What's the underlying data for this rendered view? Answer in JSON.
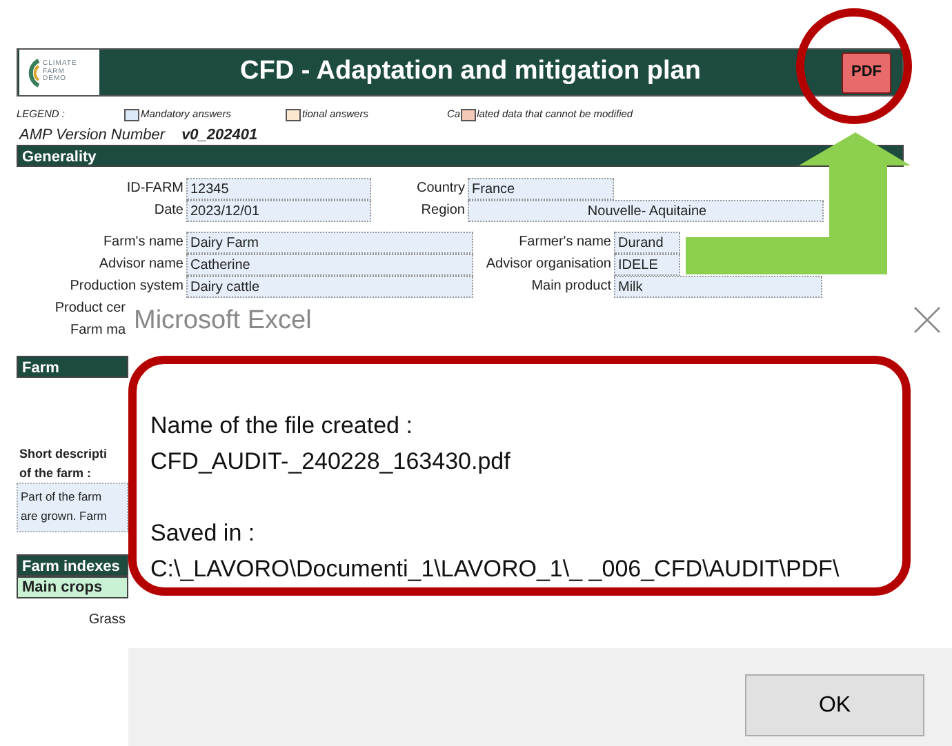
{
  "sheet": {
    "logo": {
      "lines": [
        "CLIMATE",
        "FARM",
        "DEMO"
      ]
    },
    "title": "CFD - Adaptation and mitigation plan",
    "pdf_button": {
      "label": "PDF"
    },
    "legend": {
      "label": "LEGEND :",
      "items": [
        {
          "text": "Mandatory answers",
          "color": "#dce9f7"
        },
        {
          "text": "tional answers",
          "color": "#fbe7d0"
        },
        {
          "prefix": "Ca",
          "text": "lated data that cannot be modified",
          "color": "#f4c9b8"
        }
      ]
    },
    "version": {
      "label": "AMP Version Number",
      "value": "v0_202401"
    },
    "generality": {
      "title": "Generality",
      "rows_a": [
        [
          {
            "label": "ID-FARM",
            "value": "12345"
          },
          {
            "label": "Country",
            "value": "France"
          }
        ],
        [
          {
            "label": "Date",
            "value": "2023/12/01"
          },
          {
            "label": "Region",
            "value": "Nouvelle- Aquitaine"
          }
        ]
      ],
      "rows_b": [
        [
          {
            "label": "Farm's name",
            "value": "Dairy Farm"
          },
          {
            "label": "Farmer's name",
            "value": "Durand"
          }
        ],
        [
          {
            "label": "Advisor name",
            "value": "Catherine"
          },
          {
            "label": "Advisor organisation",
            "value": "IDELE"
          }
        ],
        [
          {
            "label": "Production system",
            "value": "Dairy cattle"
          },
          {
            "label": "Main product",
            "value": "Milk"
          }
        ],
        [
          {
            "label": "Product cer"
          }
        ],
        [
          {
            "label": "Farm ma"
          }
        ]
      ]
    },
    "farm": {
      "title": "Farm",
      "description_label": [
        "Short descripti",
        "of the farm :"
      ],
      "description_lines": [
        "Part of the farm",
        "are grown. Farm"
      ]
    },
    "indexes": {
      "title": "Farm indexes",
      "subtitle": "Main crops",
      "rows": [
        {
          "label": "Grass"
        }
      ]
    }
  },
  "dialog": {
    "title": "Microsoft Excel",
    "blocks": [
      {
        "label": "Name of the file created :",
        "value": "CFD_AUDIT-_240228_163430.pdf"
      },
      {
        "label": "Saved in :",
        "value": "C:\\_LAVORO\\Documenti_1\\LAVORO_1\\_ _006_CFD\\AUDIT\\PDF\\"
      }
    ],
    "buttons": [
      "OK"
    ]
  }
}
